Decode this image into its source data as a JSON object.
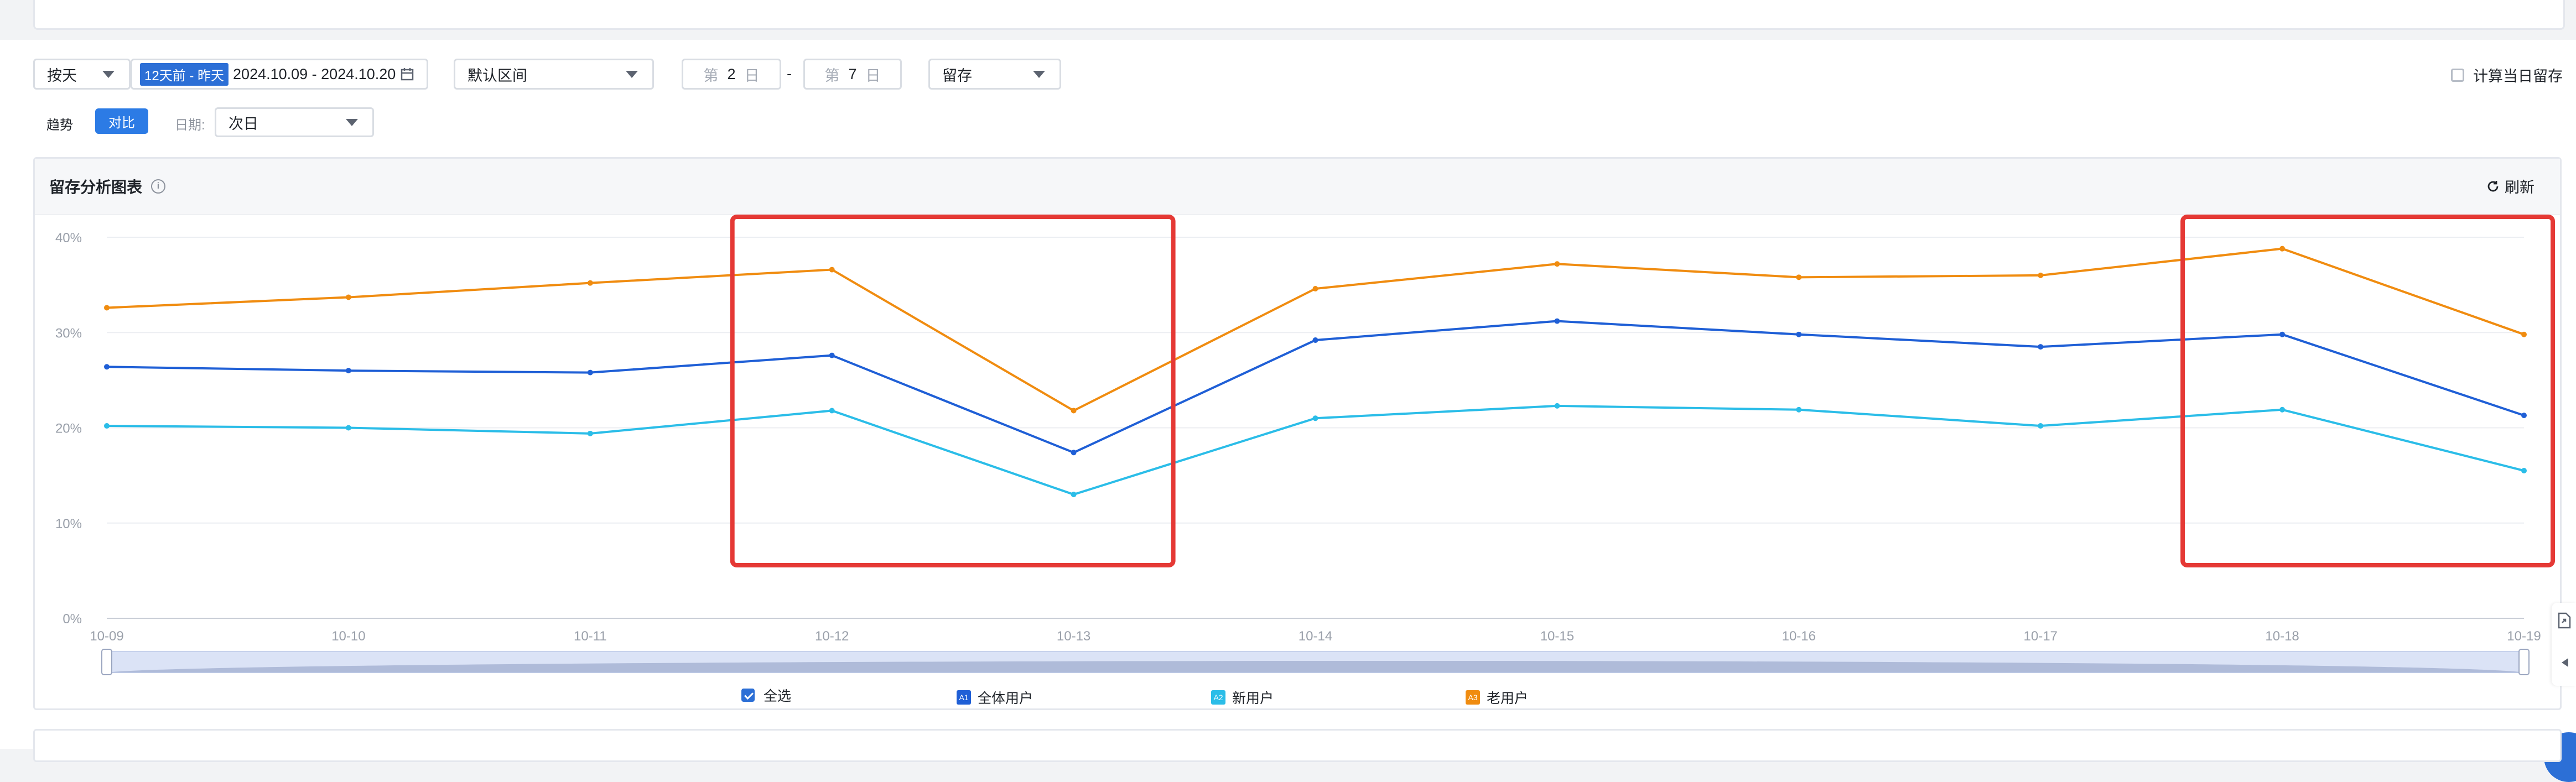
{
  "toolbar": {
    "granularity": "按天",
    "date_range_tag": "12天前 - 昨天",
    "date_range_text": "2024.10.09 - 2024.10.20",
    "interval": "默认区间",
    "day_prefix": "第",
    "day_suffix": "日",
    "day_from": "2",
    "day_to": "7",
    "range_sep": "-",
    "metric": "留存",
    "calc_today_label": "计算当日留存"
  },
  "view": {
    "trend_label": "趋势",
    "compare_label": "对比",
    "date_label": "日期:",
    "date_value": "次日"
  },
  "chart_header": {
    "title": "留存分析图表",
    "info_glyph": "i",
    "refresh_label": "刷新"
  },
  "legend": {
    "select_all": "全选",
    "items": [
      {
        "badge": "A1",
        "label": "全体用户",
        "color": "#1f5fd6"
      },
      {
        "badge": "A2",
        "label": "新用户",
        "color": "#2bbde8"
      },
      {
        "badge": "A3",
        "label": "老用户",
        "color": "#f08c10"
      }
    ]
  },
  "chart_data": {
    "type": "line",
    "categories": [
      "10-09",
      "10-10",
      "10-11",
      "10-12",
      "10-13",
      "10-14",
      "10-15",
      "10-16",
      "10-17",
      "10-18",
      "10-19"
    ],
    "y_ticks": [
      "0%",
      "10%",
      "20%",
      "30%",
      "40%"
    ],
    "ylim": [
      0,
      40
    ],
    "grid": true,
    "legend": "bottom",
    "series": [
      {
        "name": "全体用户",
        "color": "#1f5fd6",
        "values": [
          26.4,
          26.0,
          25.8,
          27.6,
          17.4,
          29.2,
          31.2,
          29.8,
          28.5,
          29.8,
          21.3
        ]
      },
      {
        "name": "新用户",
        "color": "#2bbde8",
        "values": [
          20.2,
          20.0,
          19.4,
          21.8,
          13.0,
          21.0,
          22.3,
          21.9,
          20.2,
          21.9,
          15.5
        ]
      },
      {
        "name": "老用户",
        "color": "#f08c10",
        "values": [
          32.6,
          33.7,
          35.2,
          36.6,
          21.8,
          34.6,
          37.2,
          35.8,
          36.0,
          38.8,
          29.8
        ]
      }
    ],
    "highlight_boxes": [
      {
        "from": "10-12",
        "to": "10-13"
      },
      {
        "from": "10-18",
        "to": "10-19"
      }
    ]
  }
}
